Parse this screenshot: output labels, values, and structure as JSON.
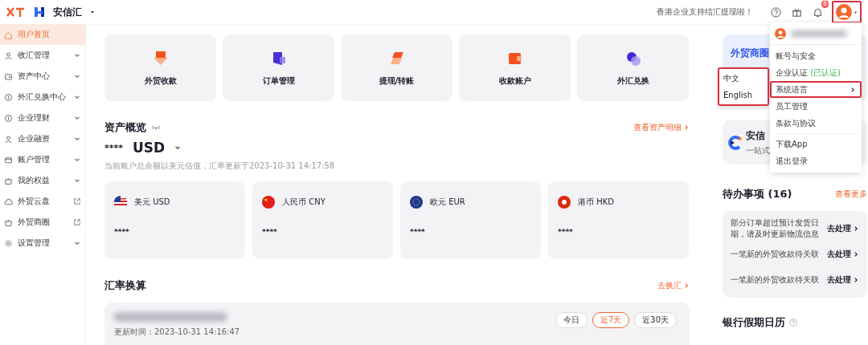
{
  "header": {
    "brand": "安信汇",
    "notice": "香港企业支持结汇提现啦！",
    "notification_count": "8",
    "avatar_highlighted": true
  },
  "sidebar": {
    "items": [
      {
        "label": "用户首页",
        "selected": true,
        "kind": "plain"
      },
      {
        "label": "收汇管理",
        "selected": false,
        "kind": "expand"
      },
      {
        "label": "资产中心",
        "selected": false,
        "kind": "expand"
      },
      {
        "label": "外汇兑换中心",
        "selected": false,
        "kind": "expand"
      },
      {
        "label": "企业理财",
        "selected": false,
        "kind": "expand"
      },
      {
        "label": "企业融资",
        "selected": false,
        "kind": "expand"
      },
      {
        "label": "账户管理",
        "selected": false,
        "kind": "expand"
      },
      {
        "label": "我的权益",
        "selected": false,
        "kind": "expand"
      },
      {
        "label": "外贸云盘",
        "selected": false,
        "kind": "external"
      },
      {
        "label": "外贸商圈",
        "selected": false,
        "kind": "external"
      },
      {
        "label": "设置管理",
        "selected": false,
        "kind": "expand"
      }
    ]
  },
  "actions": [
    {
      "label": "外贸收款"
    },
    {
      "label": "订单管理"
    },
    {
      "label": "提现/转账"
    },
    {
      "label": "收款账户"
    },
    {
      "label": "外汇兑换"
    }
  ],
  "assets": {
    "title": "资产概览",
    "link": "查看资产明细",
    "balance": "****",
    "currency": "USD",
    "note": "当前账户总余额以美元估值，汇率更新于2023-10-31 14:17:58",
    "cards": [
      {
        "label": "美元 USD",
        "amount": "****"
      },
      {
        "label": "人民币 CNY",
        "amount": "****"
      },
      {
        "label": "欧元 EUR",
        "amount": "****"
      },
      {
        "label": "港币 HKD",
        "amount": "****"
      }
    ]
  },
  "rates": {
    "title": "汇率换算",
    "link": "去换汇",
    "updated": "更新时间：2023-10-31 14:16:47",
    "periods": [
      {
        "label": "今日",
        "selected": false
      },
      {
        "label": "近7天",
        "selected": true
      },
      {
        "label": "近30天",
        "selected": false
      }
    ]
  },
  "promo": {
    "title": "外贸商圈",
    "subtitle": "安信",
    "caption": "一站式"
  },
  "todo": {
    "title": "待办事项 (16)",
    "link": "查看更多",
    "items": [
      {
        "text": "部分订单超过预计发货日期，请及时更新物流信息",
        "action": "去处理"
      },
      {
        "text": "一笔新的外贸收款待关联",
        "action": "去处理"
      },
      {
        "text": "一笔新的外贸收款待关联",
        "action": "去处理"
      }
    ]
  },
  "holidays": {
    "title": "银行假期日历"
  },
  "user_menu": {
    "items": [
      {
        "label": "账号与安全",
        "kind": "plain",
        "highlighted": false
      },
      {
        "label": "企业认证",
        "tag": "(已认证)",
        "kind": "tagged",
        "highlighted": false
      },
      {
        "label": "系统语言",
        "kind": "submenu",
        "highlighted": true
      },
      {
        "label": "员工管理",
        "kind": "plain",
        "highlighted": false
      },
      {
        "label": "条款与协议",
        "kind": "plain",
        "highlighted": false
      },
      {
        "label": "下载App",
        "kind": "plain",
        "highlighted": false
      },
      {
        "label": "退出登录",
        "kind": "plain",
        "highlighted": false
      }
    ]
  },
  "language_menu": {
    "highlighted": true,
    "options": [
      "中文",
      "English"
    ]
  }
}
